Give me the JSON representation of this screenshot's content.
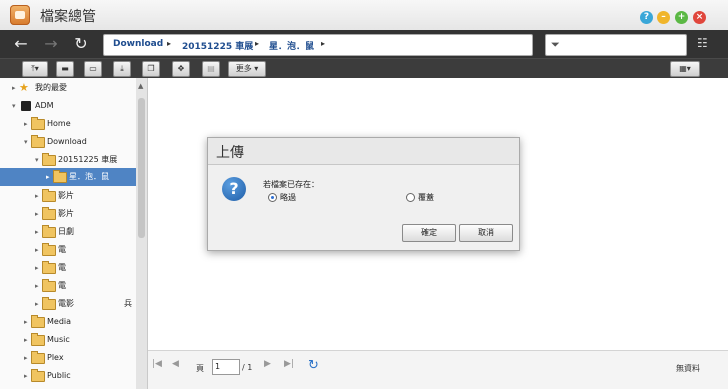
{
  "window": {
    "title": "檔案總管"
  },
  "breadcrumb": [
    "Download",
    "20151225 車展",
    "星．泡．鼠"
  ],
  "toolbar": {
    "more_label": "更多"
  },
  "tree": [
    {
      "label": "我的最愛",
      "type": "star"
    },
    {
      "label": "ADM",
      "type": "drive"
    },
    {
      "label": "Home",
      "type": "folder"
    },
    {
      "label": "Download",
      "type": "folder"
    },
    {
      "label": "20151225 車展",
      "type": "folder"
    },
    {
      "label": "星．泡．鼠",
      "type": "folder",
      "selected": true
    },
    {
      "label": "影片",
      "type": "folder"
    },
    {
      "label": "影片",
      "type": "folder"
    },
    {
      "label": "日劇",
      "type": "folder"
    },
    {
      "label": "電",
      "type": "folder"
    },
    {
      "label": "電",
      "type": "folder"
    },
    {
      "label": "電",
      "type": "folder"
    },
    {
      "label": "電影",
      "type": "folder",
      "suffix": "兵"
    },
    {
      "label": "Media",
      "type": "folder"
    },
    {
      "label": "Music",
      "type": "folder"
    },
    {
      "label": "Plex",
      "type": "folder"
    },
    {
      "label": "Public",
      "type": "folder"
    }
  ],
  "pager": {
    "page_label": "頁",
    "page_value": "1",
    "total": "/ 1",
    "status": "無資料"
  },
  "dialog": {
    "title": "上傳",
    "prompt": "若檔案已存在：",
    "option_skip": "略過",
    "option_overwrite": "覆蓋",
    "ok_label": "確定",
    "cancel_label": "取消"
  }
}
